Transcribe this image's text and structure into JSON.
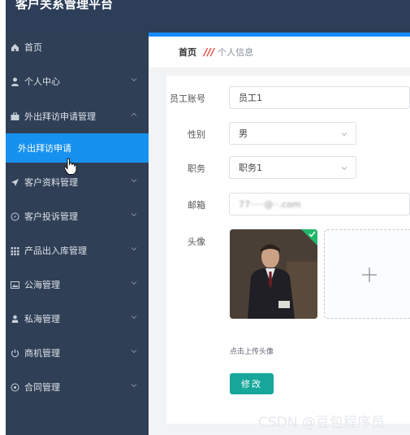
{
  "app": {
    "title": "客户关系管理平台"
  },
  "sidebar": {
    "items": [
      {
        "label": "首页",
        "icon": "home-icon"
      },
      {
        "label": "个人中心",
        "icon": "user-icon"
      },
      {
        "label": "外出拜访申请管理",
        "icon": "briefcase-icon",
        "expanded": true
      },
      {
        "label": "外出拜访申请",
        "active": true
      },
      {
        "label": "客户资料管理",
        "icon": "send-icon"
      },
      {
        "label": "客户投诉管理",
        "icon": "compass-icon"
      },
      {
        "label": "产品出入库管理",
        "icon": "grid-icon"
      },
      {
        "label": "公海管理",
        "icon": "image-icon"
      },
      {
        "label": "私海管理",
        "icon": "person-icon"
      },
      {
        "label": "商机管理",
        "icon": "power-icon"
      },
      {
        "label": "合同管理",
        "icon": "settings-icon"
      }
    ]
  },
  "breadcrumb": {
    "home": "首页",
    "current": "个人信息"
  },
  "form": {
    "account_label": "员工账号",
    "account_value": "员工1",
    "gender_label": "性别",
    "gender_value": "男",
    "position_label": "职务",
    "position_value": "职务1",
    "email_label": "邮箱",
    "email_value": "77·····@··.com",
    "avatar_label": "头像",
    "upload_hint": "点击上传头像",
    "submit_label": "修改"
  },
  "watermark": "CSDN @豆包程序员",
  "colors": {
    "sidebar": "#2f3f55",
    "active": "#1791f0",
    "button": "#17a79a"
  }
}
